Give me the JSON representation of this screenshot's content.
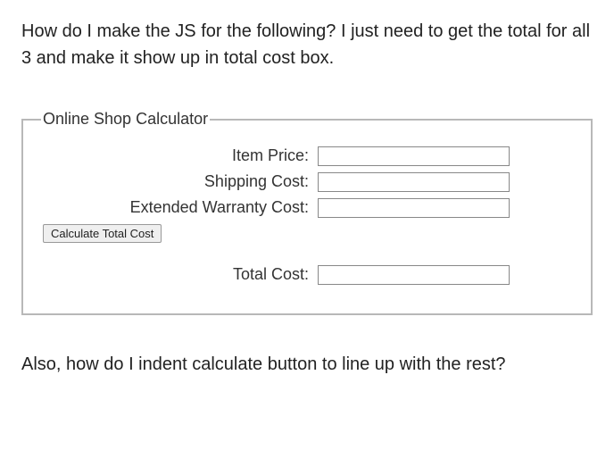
{
  "question": {
    "intro": "How do I make the JS for the following? I just need to get the total for all 3 and make it show up in total cost box.",
    "followup": "Also, how do I indent calculate button to line up with the rest?"
  },
  "form": {
    "legend": "Online Shop Calculator",
    "itemPriceLabel": "Item Price:",
    "shippingCostLabel": "Shipping Cost:",
    "warrantyCostLabel": "Extended Warranty Cost:",
    "calculateButtonLabel": "Calculate Total Cost",
    "totalCostLabel": "Total Cost:"
  }
}
